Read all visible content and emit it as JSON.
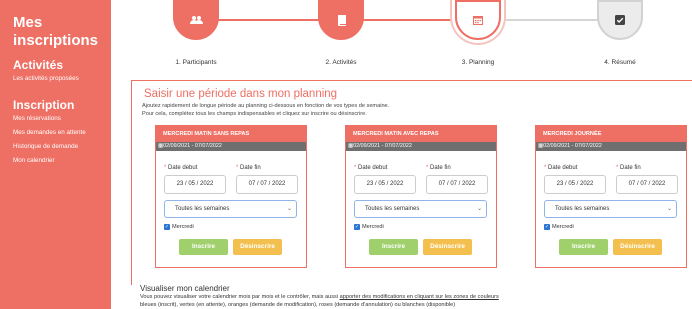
{
  "sidebar": {
    "title": "Mes inscriptions",
    "sections": [
      {
        "heading": "Activités",
        "links": [
          "Les activités proposées"
        ]
      },
      {
        "heading": "Inscription",
        "links": [
          "Mes réservations",
          "Mes demandes en attente",
          "Historique de demande",
          "Mon calendrier"
        ]
      }
    ]
  },
  "steps": [
    {
      "label": "1. Participants",
      "icon": "users-icon",
      "state": "done"
    },
    {
      "label": "2. Activités",
      "icon": "book-icon",
      "state": "done"
    },
    {
      "label": "3. Planning",
      "icon": "calendar-icon",
      "state": "active"
    },
    {
      "label": "4. Résumé",
      "icon": "check-square-icon",
      "state": "todo"
    }
  ],
  "panel": {
    "title": "Saisir une période dans mon planning",
    "desc_line1": "Ajoutez rapidement de longue période au planning ci-dessous en fonction de vos types de semaine.",
    "desc_line2": "Pour cela, complétez tous les champs indispensables et cliquez sur inscrire ou désinscrire."
  },
  "form_labels": {
    "date_debut": "Date debut",
    "date_fin": "Date fin",
    "required_mark": "*",
    "week_select": "Toutes les semaines",
    "checkbox": "Mercredi",
    "inscrire": "Inscrire",
    "desinscrire": "Désinscrire"
  },
  "cards": [
    {
      "title": "MERCREDI MATIN SANS REPAS",
      "period": "02/09/2021 - 07/07/2022",
      "start": "23 / 05 / 2022",
      "end": "07 / 07 / 2022"
    },
    {
      "title": "MERCREDI MATIN AVEC REPAS",
      "period": "02/09/2021 - 07/07/2022",
      "start": "23 / 05 / 2022",
      "end": "07 / 07 / 2022"
    },
    {
      "title": "MERCREDI JOURNÉE",
      "period": "02/09/2021 - 07/07/2022",
      "start": "23 / 05 / 2022",
      "end": "07 / 07 / 2022"
    }
  ],
  "calendar": {
    "title": "Visualiser mon calendrier",
    "desc_pre": "Vous pouvez visualiser votre calendrier mois par mois et le contrôler, mais aussi ",
    "desc_link": "apporter des modifications en cliquant sur les zones de couleurs",
    "desc_line2": "bleues (inscrit), vertes (en attente), oranges (demande de modification), roses (demande d'annulation) ou blanches (disponible)"
  },
  "colors": {
    "accent": "#ee6f63",
    "green": "#9fd06b",
    "yellow": "#f3c04f",
    "period_bar": "#6f6f6f"
  }
}
